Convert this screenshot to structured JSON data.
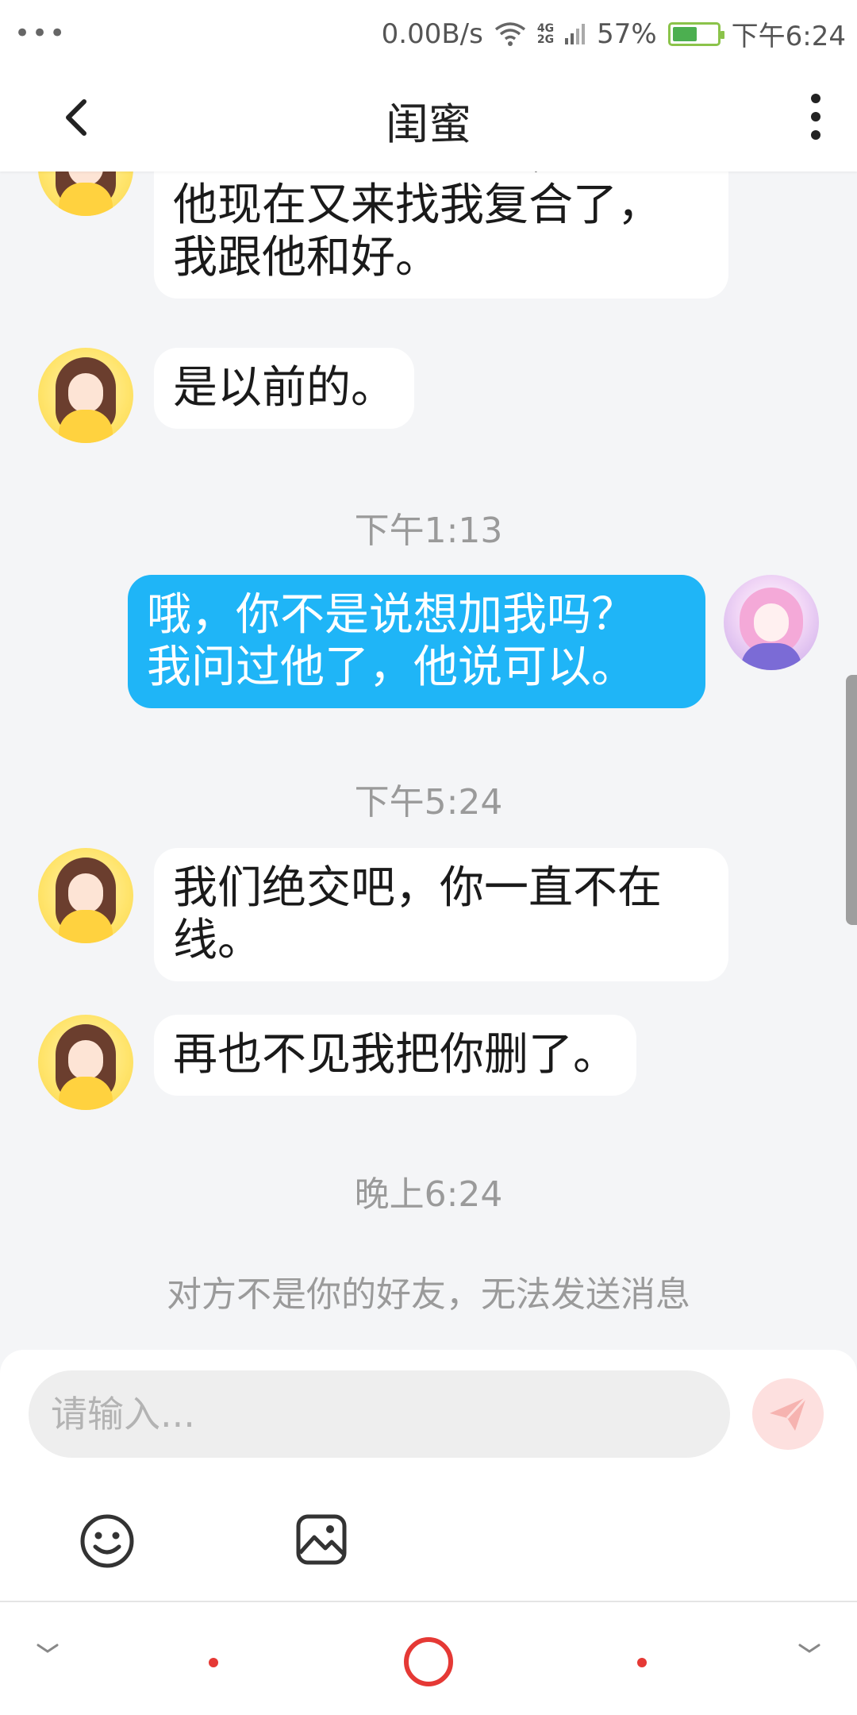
{
  "status_bar": {
    "net_speed": "0.00B/s",
    "net_type_top": "4G",
    "net_type_bottom": "2G",
    "battery_percent": "57%",
    "battery_level": 0.57,
    "time": "下午6:24"
  },
  "header": {
    "title": "闺蜜"
  },
  "messages": [
    {
      "side": "in",
      "text": "我说的是我的闺蜜，但是\n他现在又来找我复合了，\n我跟他和好。"
    },
    {
      "side": "in",
      "text": "是以前的。"
    },
    {
      "side": "out",
      "text": "哦，你不是说想加我吗？\n我问过他了，他说可以。"
    },
    {
      "side": "in",
      "text": "我们绝交吧，你一直不在\n线。"
    },
    {
      "side": "in",
      "text": "再也不见我把你删了。"
    }
  ],
  "timestamps": [
    "下午1:13",
    "下午5:24",
    "晚上6:24"
  ],
  "notice": "对方不是你的好友，无法发送消息",
  "composer": {
    "placeholder": "请输入..."
  },
  "colors": {
    "outgoing_bubble": "#1fb5f7",
    "incoming_bubble": "#ffffff",
    "send_button": "#fde0df",
    "nav_accent": "#e53935"
  },
  "icons": {
    "back": "chevron-left-icon",
    "more": "more-vertical-icon",
    "send": "paper-plane-icon",
    "emoji": "smiley-icon",
    "image": "image-icon"
  }
}
